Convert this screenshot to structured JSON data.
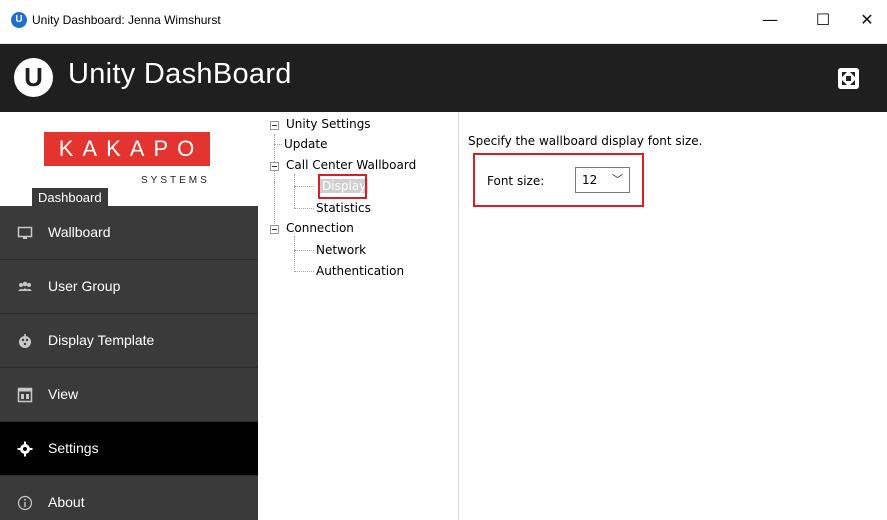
{
  "window": {
    "title": "Unity Dashboard: Jenna Wimshurst",
    "minimize_glyph": "—",
    "maximize_glyph": "☐",
    "close_glyph": "✕"
  },
  "header": {
    "logo_letter": "U",
    "app_name": "Unity DashBoard",
    "expand_icon": "expand-icon"
  },
  "brand": {
    "name": "KAKAPO",
    "subtitle": "SYSTEMS",
    "section_tab": "Dashboard",
    "colors": {
      "brand_red": "#e3342f"
    }
  },
  "sidebar": {
    "items": [
      {
        "label": "Wallboard",
        "icon": "monitor-icon",
        "active": false
      },
      {
        "label": "User Group",
        "icon": "users-icon",
        "active": false
      },
      {
        "label": "Display Template",
        "icon": "palette-icon",
        "active": false
      },
      {
        "label": "View",
        "icon": "view-icon",
        "active": false
      },
      {
        "label": "Settings",
        "icon": "gear-icon",
        "active": true
      },
      {
        "label": "About",
        "icon": "info-icon",
        "active": false
      }
    ]
  },
  "tree": {
    "root": "Unity Settings",
    "update": "Update",
    "wallboard": "Call Center Wallboard",
    "display": "Display",
    "statistics": "Statistics",
    "connection": "Connection",
    "network": "Network",
    "authentication": "Authentication"
  },
  "content": {
    "description": "Specify the wallboard display font size.",
    "font_size_label": "Font size:",
    "font_size_value": "12",
    "chevron": "﹀"
  },
  "colors": {
    "header_bg": "#1f1f1f",
    "sidebar_bg": "#3a3a3a",
    "active_bg": "#000000",
    "highlight_red": "#d71f27"
  }
}
